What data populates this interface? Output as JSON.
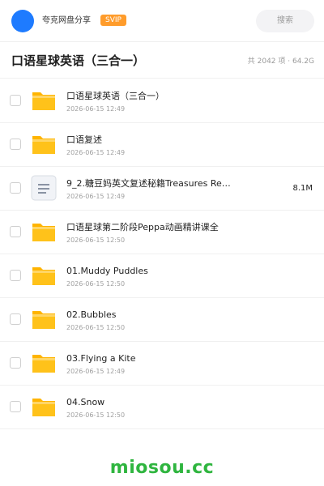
{
  "header": {
    "user_name": "夸克网盘分享",
    "vip_badge": "SVIP",
    "search_label": "搜索"
  },
  "folder": {
    "title": "口语星球英语（三合一）",
    "meta": "共 2042 项 · 64.2G"
  },
  "items": [
    {
      "name": "口语星球英语（三合一）",
      "date": "2026-06-15 12:49",
      "size": "",
      "type": "folder"
    },
    {
      "name": "口语复述",
      "date": "2026-06-15 12:49",
      "size": "",
      "type": "folder"
    },
    {
      "name": "9_2.糖豆妈英文复述秘籍Treasures Re…",
      "date": "2026-06-15 12:49",
      "size": "8.1M",
      "type": "document"
    },
    {
      "name": "口语星球第二阶段Peppa动画精讲课全",
      "date": "2026-06-15 12:50",
      "size": "",
      "type": "folder"
    },
    {
      "name": "01.Muddy Puddles",
      "date": "2026-06-15 12:50",
      "size": "",
      "type": "folder"
    },
    {
      "name": "02.Bubbles",
      "date": "2026-06-15 12:50",
      "size": "",
      "type": "folder"
    },
    {
      "name": "03.Flying a Kite",
      "date": "2026-06-15 12:49",
      "size": "",
      "type": "folder"
    },
    {
      "name": "04.Snow",
      "date": "2026-06-15 12:50",
      "size": "",
      "type": "folder"
    }
  ],
  "watermark": "miosou.cc",
  "colors": {
    "accent_blue": "#1e7bff",
    "vip_orange": "#ff9c2b",
    "folder_yellow": "#ffc21a",
    "watermark_green": "#2fb53f"
  }
}
